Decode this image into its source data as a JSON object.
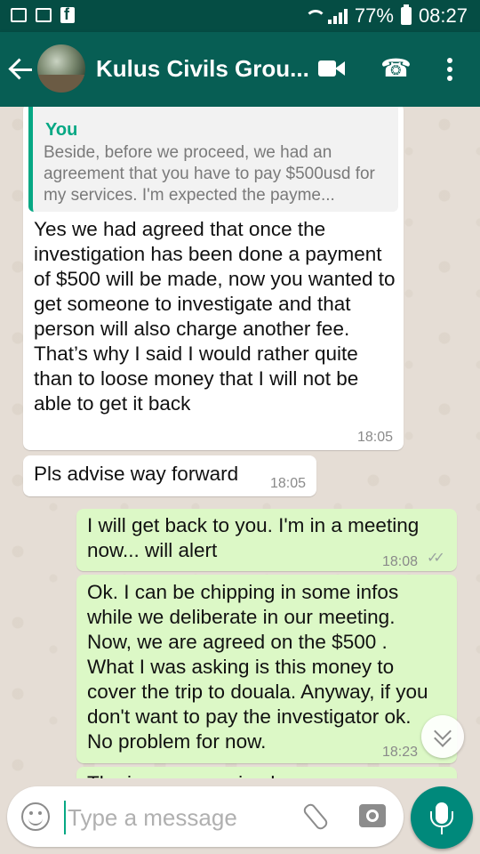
{
  "status_bar": {
    "battery": "77%",
    "time": "08:27"
  },
  "header": {
    "title": "Kulus Civils Grou..."
  },
  "messages": [
    {
      "quote_author": "You",
      "quote_text": "Beside, before we proceed, we had an agreement that you have to pay $500usd for my services. I'm expected the payme...",
      "text": "Yes we had agreed that once the investigation has been done a payment of $500 will be made, now you wanted to get someone to investigate and that person will also charge another fee.\nThat’s why I said I would rather quite than to loose money that I will not be able to get it back",
      "time": "18:05"
    },
    {
      "text": "Pls advise way forward",
      "time": "18:05"
    },
    {
      "text": "I will get back to you. I'm in a meeting now... will alert",
      "time": "18:08"
    },
    {
      "text": "Ok. I can be chipping in some infos while we deliberate in our meeting. Now, we are agreed on the $500 . What I was asking is this money to cover the trip to douala.  Anyway, if you don't want to pay the investigator ok. No problem for now.",
      "time": "18:23"
    },
    {
      "text": "The issue was raised ..."
    }
  ],
  "input": {
    "placeholder": "Type a message"
  }
}
